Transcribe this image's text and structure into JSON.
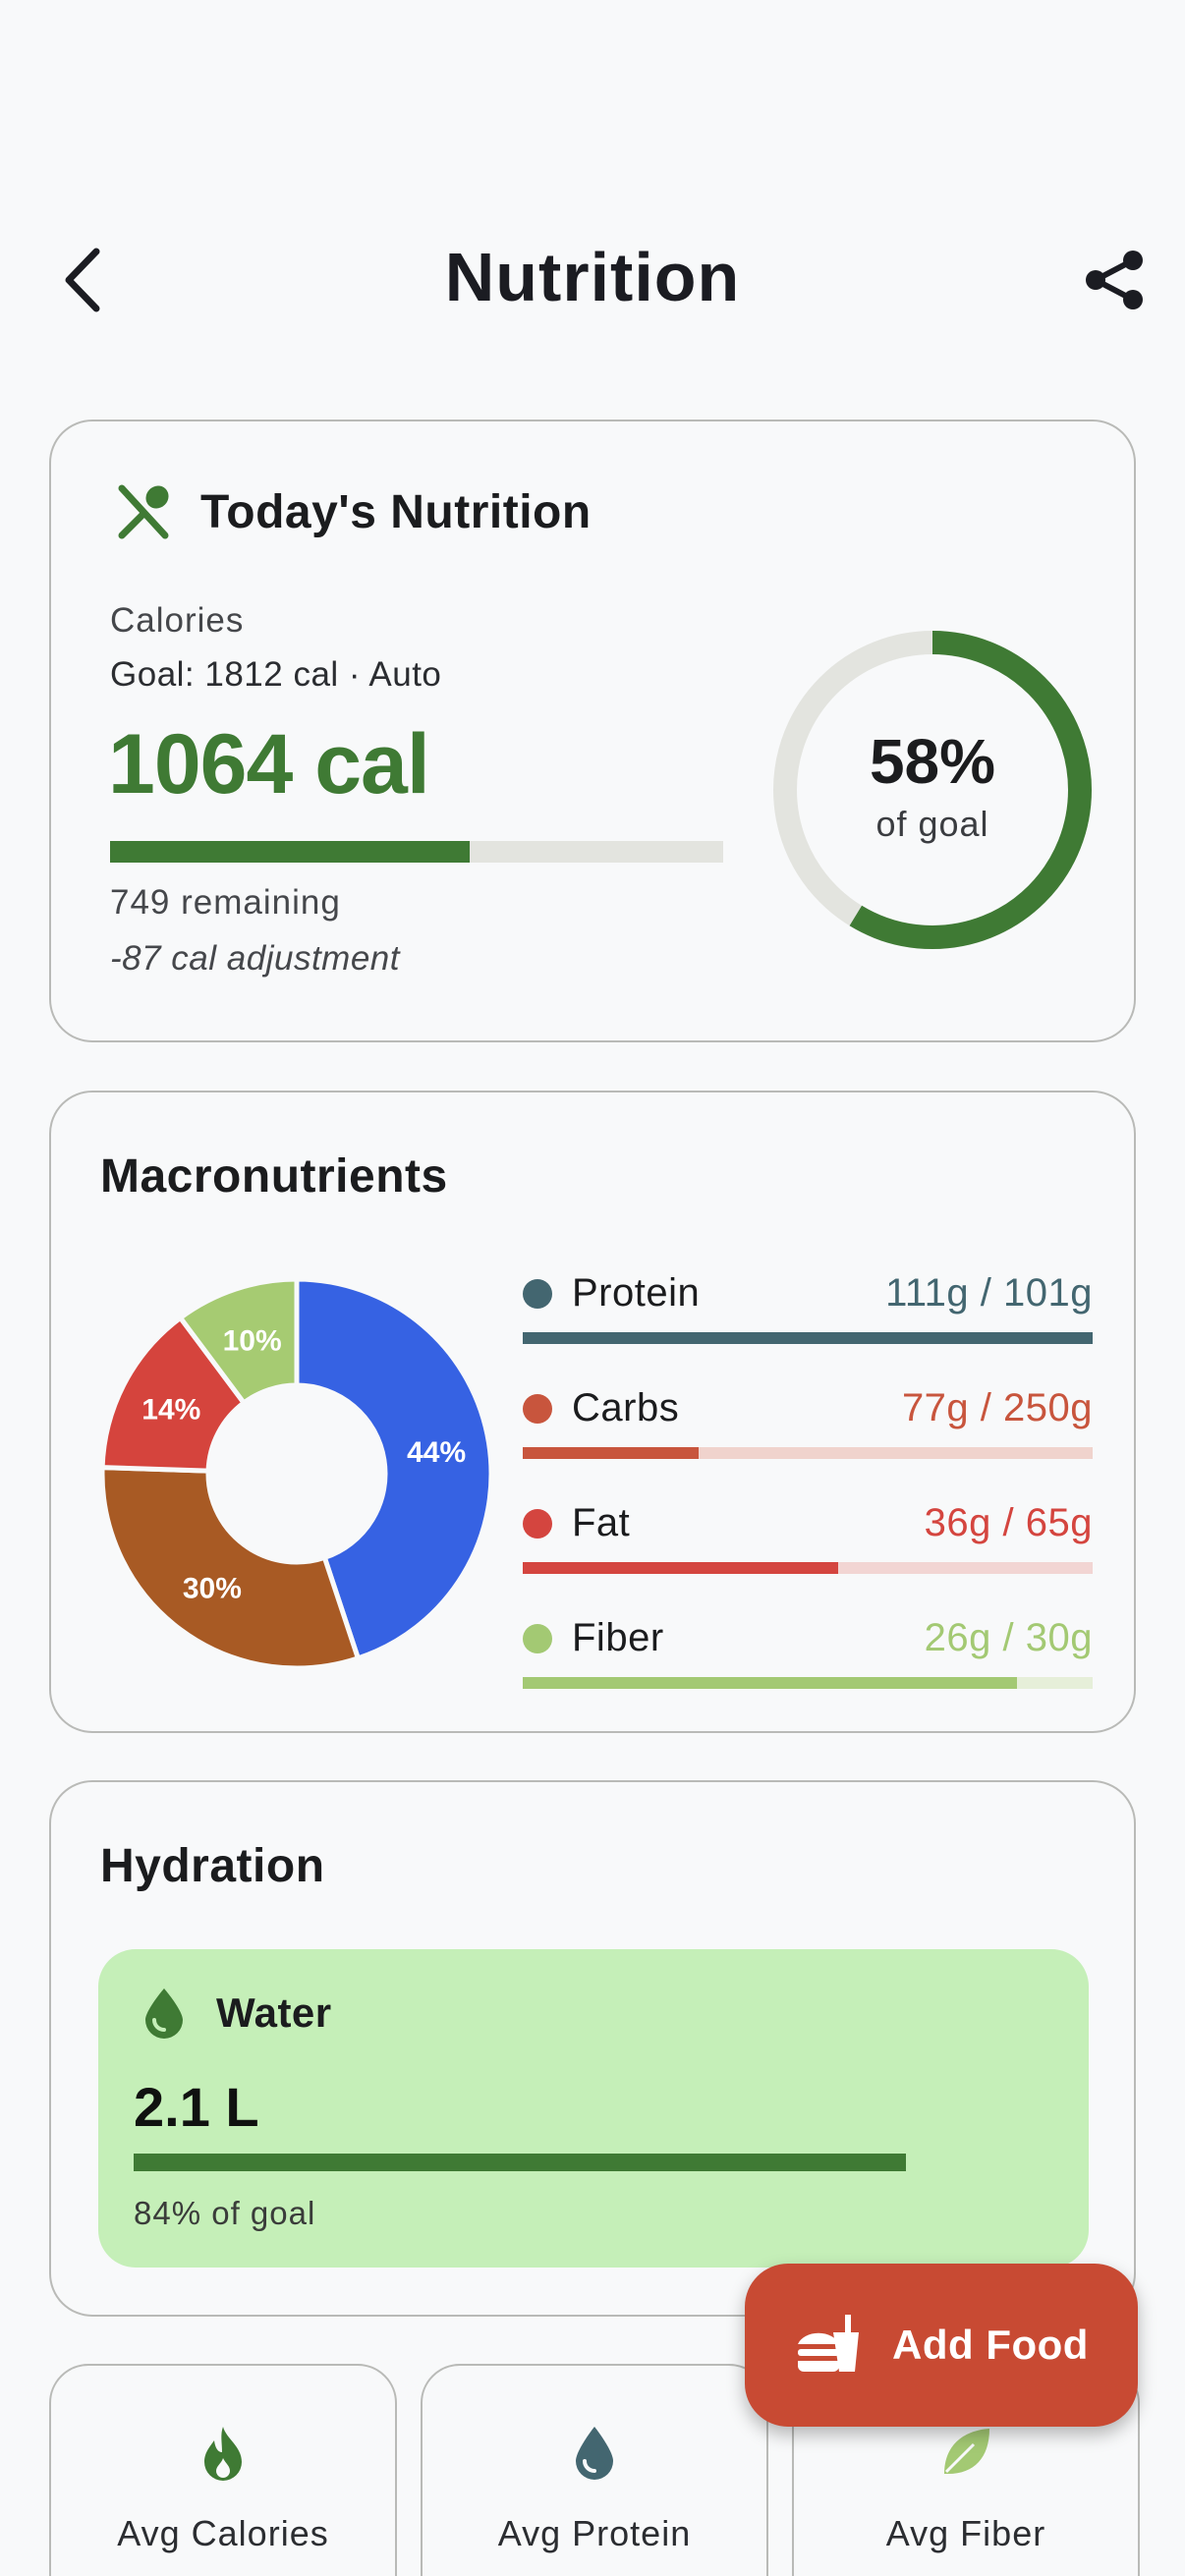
{
  "header": {
    "title": "Nutrition",
    "back_icon": "chevron-left-icon",
    "share_icon": "share-icon"
  },
  "today": {
    "title": "Today's Nutrition",
    "icon": "utensils-icon",
    "calories_label": "Calories",
    "goal_text": "Goal: 1812 cal · Auto",
    "calories_value": "1064 cal",
    "calories_progress": 0.587,
    "remaining_text": "749 remaining",
    "adjustment_text": "-87 cal adjustment",
    "ring_percent": "58%",
    "ring_value": 0.587,
    "ring_sub": "of goal"
  },
  "macros": {
    "title": "Macronutrients",
    "items": [
      {
        "name": "Protein",
        "amount": "111g / 101g",
        "progress": 1.0,
        "color": "#436670",
        "track": "#436670"
      },
      {
        "name": "Carbs",
        "amount": "77g / 250g",
        "progress": 0.308,
        "color": "#c8553d",
        "track": "#f0d3cd"
      },
      {
        "name": "Fat",
        "amount": "36g / 65g",
        "progress": 0.554,
        "color": "#d4453f",
        "track": "#f2d5d3"
      },
      {
        "name": "Fiber",
        "amount": "26g / 30g",
        "progress": 0.867,
        "color": "#a3c973",
        "track": "#e6efd9"
      }
    ]
  },
  "chart_data": {
    "type": "pie",
    "categories": [
      "Protein",
      "Carbs",
      "Fat",
      "Fiber"
    ],
    "values": [
      44,
      30,
      14,
      10
    ],
    "labels": [
      "44%",
      "30%",
      "14%",
      "10%"
    ],
    "colors": [
      "#3662e3",
      "#a85a24",
      "#d5443d",
      "#a6cb72"
    ]
  },
  "hydration": {
    "title": "Hydration",
    "water_label": "Water",
    "water_icon": "water-drop-icon",
    "value": "2.1 L",
    "progress": 0.84,
    "percent_text": "84% of goal"
  },
  "stats": [
    {
      "label": "Avg Calories",
      "icon": "flame-icon",
      "color": "#3f7a34"
    },
    {
      "label": "Avg Protein",
      "icon": "water-drop-icon",
      "color": "#436670"
    },
    {
      "label": "Avg Fiber",
      "icon": "leaf-icon",
      "color": "#a3c973"
    }
  ],
  "fab": {
    "label": "Add Food",
    "icon": "fast-food-icon"
  }
}
